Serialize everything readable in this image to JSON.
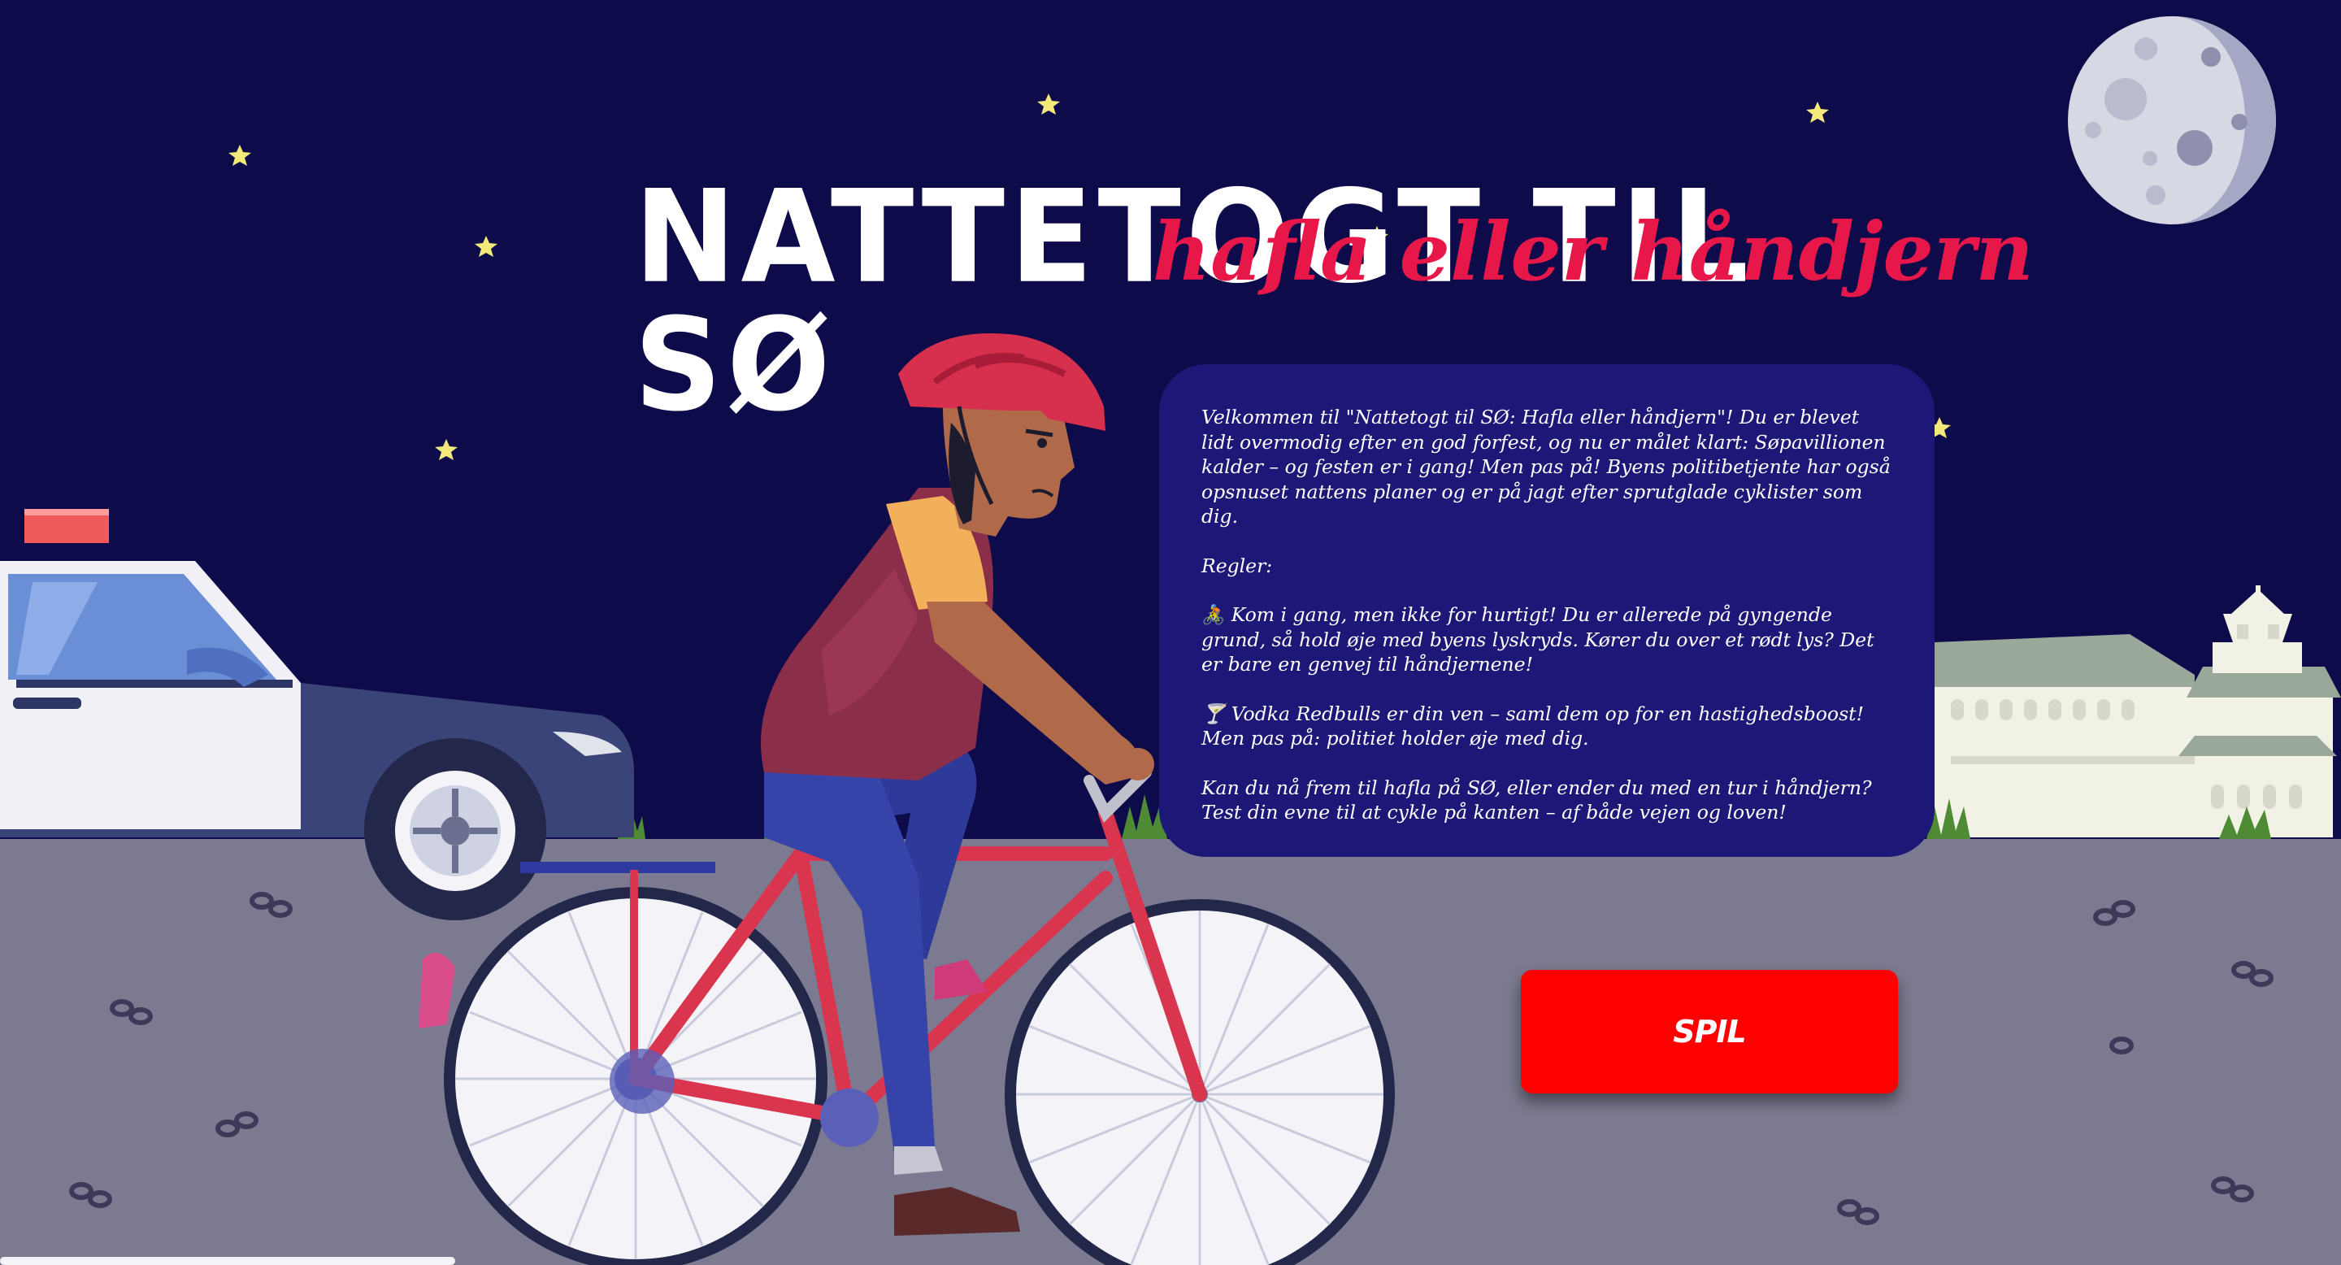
{
  "game": {
    "title": "NATTETOGT TIL SØ",
    "subtitle": "hafla eller håndjern"
  },
  "intro": {
    "welcome": "Velkommen til \"Nattetogt til SØ: Hafla eller håndjern\"! Du er blevet lidt overmodig efter en god forfest, og nu er målet klart: Søpavillionen kalder – og festen er i gang! Men pas på! Byens politibetjente har også opsnuset nattens planer og er på jagt efter sprutglade cyklister som dig.",
    "rules_heading": "Regler:",
    "rule_1": "🚴 Kom i gang, men ikke for hurtigt! Du er allerede på gyngende grund, så hold øje med byens lyskryds. Kører du over et rødt lys? Det er bare en genvej til håndjernene!",
    "rule_2": "🍸 Vodka Redbulls er din ven – saml dem op for en hastighedsboost! Men pas på: politiet holder øje med dig.",
    "closing": "Kan du nå frem til hafla på SØ, eller ender du med en tur i håndjern? Test din evne til at cykle på kanten – af både vejen og loven!"
  },
  "play_button": {
    "label": "SPIL"
  },
  "colors": {
    "sky": "#0e0b4a",
    "road": "#7c7a90",
    "title": "#ffffff",
    "subtitle": "#e8174a",
    "panel": "#1d1878",
    "button": "#ff0000"
  },
  "icons": [
    "moon-icon",
    "star-icon",
    "police-car",
    "cyclist",
    "pavilion-building",
    "handcuffs-icon"
  ]
}
